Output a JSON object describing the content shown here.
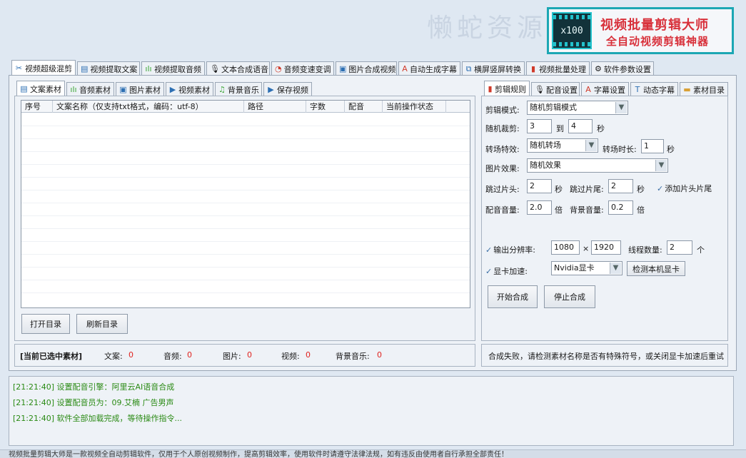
{
  "banner": {
    "watermark": "懒蛇资源",
    "logo_text": "x100",
    "title": "视频批量剪辑大师",
    "subtitle": "全自动视频剪辑神器"
  },
  "main_tabs": [
    {
      "label": "视频超级混剪",
      "icon": "scissors-icon"
    },
    {
      "label": "视频提取文案",
      "icon": "document-icon"
    },
    {
      "label": "视频提取音频",
      "icon": "audio-wave-icon"
    },
    {
      "label": "文本合成语音",
      "icon": "microphone-icon"
    },
    {
      "label": "音频变速变调",
      "icon": "gauge-icon"
    },
    {
      "label": "图片合成视频",
      "icon": "image-icon"
    },
    {
      "label": "自动生成字幕",
      "icon": "text-icon"
    },
    {
      "label": "横屏竖屏转换",
      "icon": "rotate-screen-icon"
    },
    {
      "label": "视频批量处理",
      "icon": "film-icon"
    },
    {
      "label": "软件参数设置",
      "icon": "gear-icon"
    }
  ],
  "sub_tabs": [
    {
      "label": "文案素材",
      "icon": "document-icon"
    },
    {
      "label": "音频素材",
      "icon": "audio-wave-icon"
    },
    {
      "label": "图片素材",
      "icon": "image-icon"
    },
    {
      "label": "视频素材",
      "icon": "play-icon"
    },
    {
      "label": "背景音乐",
      "icon": "music-note-icon"
    },
    {
      "label": "保存视频",
      "icon": "save-icon"
    }
  ],
  "table": {
    "columns": [
      "序号",
      "文案名称（仅支持txt格式，编码：utf-8）",
      "路径",
      "字数",
      "配音",
      "当前操作状态"
    ],
    "rows": []
  },
  "buttons": {
    "open_dir": "打开目录",
    "refresh_dir": "刷新目录",
    "start": "开始合成",
    "stop": "停止合成",
    "detect_gpu": "检测本机显卡"
  },
  "selected": {
    "label": "[当前已选中素材]",
    "text_label": "文案:",
    "text_val": "0",
    "audio_label": "音频:",
    "audio_val": "0",
    "image_label": "图片:",
    "image_val": "0",
    "video_label": "视频:",
    "video_val": "0",
    "bgm_label": "背景音乐:",
    "bgm_val": "0"
  },
  "right_tabs": [
    {
      "label": "剪辑规则",
      "icon": "film-icon"
    },
    {
      "label": "配音设置",
      "icon": "microphone-icon"
    },
    {
      "label": "字幕设置",
      "icon": "text-icon"
    },
    {
      "label": "动态字幕",
      "icon": "text-box-icon"
    },
    {
      "label": "素材目录",
      "icon": "folder-icon"
    }
  ],
  "settings": {
    "edit_mode_label": "剪辑模式:",
    "edit_mode": "随机剪辑模式",
    "random_cut_label": "随机裁剪:",
    "cut_from": "3",
    "to": "到",
    "cut_to": "4",
    "sec": "秒",
    "transition_label": "转场特效:",
    "transition": "随机转场",
    "transition_dur_label": "转场时长:",
    "transition_dur": "1",
    "image_effect_label": "图片效果:",
    "image_effect": "随机效果",
    "skip_head_label": "跳过片头:",
    "skip_head": "2",
    "skip_tail_label": "跳过片尾:",
    "skip_tail": "2",
    "add_head_tail": "添加片头片尾",
    "voice_vol_label": "配音音量:",
    "voice_vol": "2.0",
    "times": "倍",
    "bg_vol_label": "背景音量:",
    "bg_vol": "0.2",
    "resolution_label": "输出分辨率:",
    "res_w": "1080",
    "res_x": "×",
    "res_h": "1920",
    "threads_label": "线程数量:",
    "threads": "2",
    "unit": "个",
    "gpu_label": "显卡加速:",
    "gpu": "Nvidia显卡"
  },
  "status_message": "合成失败，请检测素材名称是否有特殊符号，或关闭显卡加速后重试",
  "log": [
    "[21:21:40] 设置配音引擎：阿里云AI语音合成",
    "[21:21:40] 设置配音员为：09.艾楠 广告男声",
    "[21:21:40] 软件全部加载完成，等待操作指令..."
  ],
  "footer": "视频批量剪辑大师是一款视频全自动剪辑软件，仅用于个人原创视频制作，提高剪辑效率，使用软件时请遵守法律法规，如有违反由使用者自行承担全部责任！",
  "colors": {
    "accent_red": "#d8303a",
    "log_green": "#2a8a14",
    "banner_border": "#1ca7b4"
  }
}
